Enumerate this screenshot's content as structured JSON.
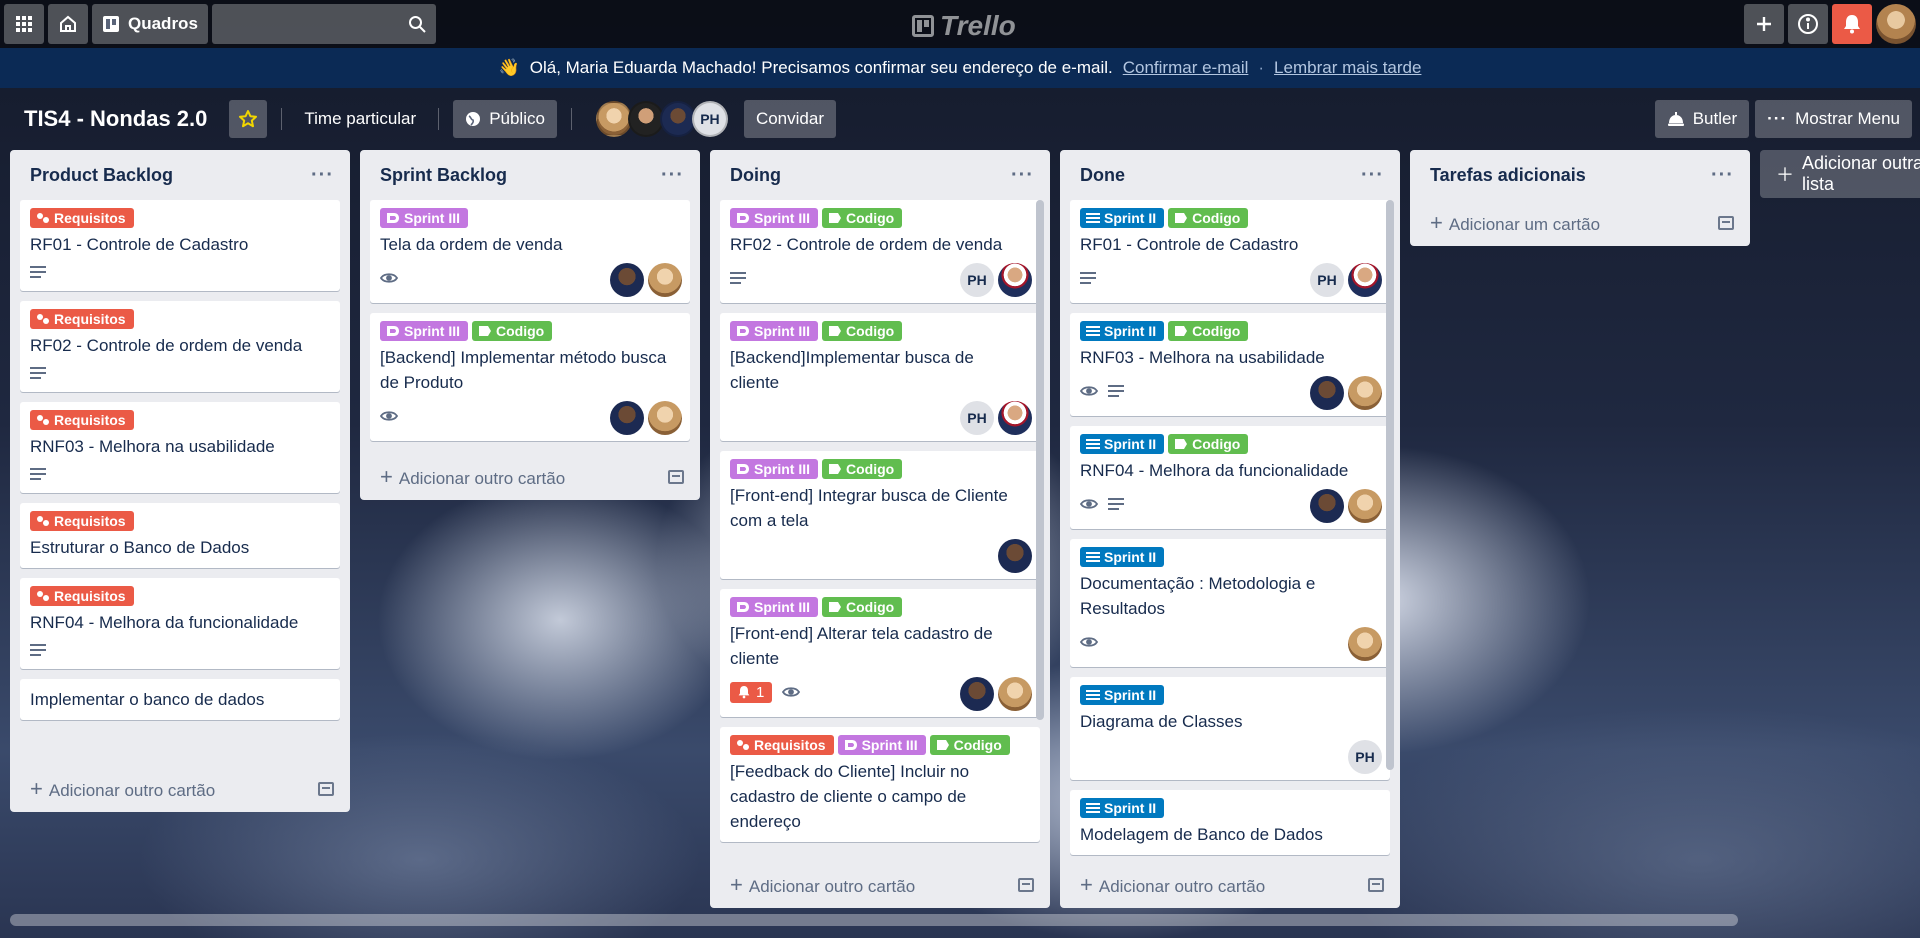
{
  "header": {
    "apps_icon": "grid-icon",
    "home_icon": "home-icon",
    "boards_label": "Quadros",
    "search_placeholder": "",
    "logo_text": "Trello"
  },
  "banner": {
    "emoji": "👋",
    "message": "Olá, Maria Eduarda Machado! Precisamos confirmar seu endereço de e-mail.",
    "confirm_link": "Confirmar e-mail",
    "separator": "·",
    "later_link": "Lembrar mais tarde"
  },
  "board": {
    "title": "TIS4 - Nondas 2.0",
    "team_label": "Time particular",
    "visibility_label": "Público",
    "invite_label": "Convidar",
    "member_initials": "PH",
    "butler_label": "Butler",
    "menu_label": "Mostrar Menu"
  },
  "lists": [
    {
      "title": "Product Backlog",
      "add_label": "Adicionar outro cartão",
      "cards": [
        {
          "labels": [
            {
              "text": "Requisitos",
              "kind": "req"
            }
          ],
          "title": "RF01 - Controle de Cadastro",
          "desc": true
        },
        {
          "labels": [
            {
              "text": "Requisitos",
              "kind": "req"
            }
          ],
          "title": "RF02 - Controle de ordem de venda",
          "desc": true
        },
        {
          "labels": [
            {
              "text": "Requisitos",
              "kind": "req"
            }
          ],
          "title": "RNF03 - Melhora na usabilidade",
          "desc": true
        },
        {
          "labels": [
            {
              "text": "Requisitos",
              "kind": "req"
            }
          ],
          "title": "Estruturar o Banco de Dados"
        },
        {
          "labels": [
            {
              "text": "Requisitos",
              "kind": "req"
            }
          ],
          "title": "RNF04 - Melhora da funcionalidade",
          "desc": true
        },
        {
          "labels": [],
          "title": "Implementar o banco de dados"
        }
      ]
    },
    {
      "title": "Sprint Backlog",
      "add_label": "Adicionar outro cartão",
      "cards": [
        {
          "labels": [
            {
              "text": "Sprint III",
              "kind": "s3"
            }
          ],
          "title": "Tela da ordem de venda",
          "watch": true,
          "members": [
            "d",
            "f"
          ]
        },
        {
          "labels": [
            {
              "text": "Sprint III",
              "kind": "s3"
            },
            {
              "text": "Codigo",
              "kind": "cod"
            }
          ],
          "title": "[Backend] Implementar método busca de Produto",
          "watch": true,
          "members": [
            "d",
            "f"
          ]
        }
      ]
    },
    {
      "title": "Doing",
      "add_label": "Adicionar outro cartão",
      "cards": [
        {
          "labels": [
            {
              "text": "Sprint III",
              "kind": "s3"
            },
            {
              "text": "Codigo",
              "kind": "cod"
            }
          ],
          "title": "RF02 - Controle de ordem de venda",
          "desc": true,
          "members": [
            "ph",
            "s"
          ]
        },
        {
          "labels": [
            {
              "text": "Sprint III",
              "kind": "s3"
            },
            {
              "text": "Codigo",
              "kind": "cod"
            }
          ],
          "title": "[Backend]Implementar busca de cliente",
          "members": [
            "ph",
            "s"
          ]
        },
        {
          "labels": [
            {
              "text": "Sprint III",
              "kind": "s3"
            },
            {
              "text": "Codigo",
              "kind": "cod"
            }
          ],
          "title": "[Front-end] Integrar busca de Cliente com a tela",
          "members": [
            "d"
          ]
        },
        {
          "labels": [
            {
              "text": "Sprint III",
              "kind": "s3"
            },
            {
              "text": "Codigo",
              "kind": "cod"
            }
          ],
          "title": "[Front-end] Alterar tela cadastro de cliente",
          "bell": "1",
          "watch": true,
          "members": [
            "d",
            "f"
          ]
        },
        {
          "labels": [
            {
              "text": "Requisitos",
              "kind": "req"
            },
            {
              "text": "Sprint III",
              "kind": "s3"
            },
            {
              "text": "Codigo",
              "kind": "cod"
            }
          ],
          "title": "[Feedback do Cliente] Incluir no cadastro de cliente o campo de endereço"
        }
      ]
    },
    {
      "title": "Done",
      "add_label": "Adicionar outro cartão",
      "cards": [
        {
          "labels": [
            {
              "text": "Sprint II",
              "kind": "s2"
            },
            {
              "text": "Codigo",
              "kind": "cod"
            }
          ],
          "title": "RF01 - Controle de Cadastro",
          "desc": true,
          "members": [
            "ph",
            "s"
          ]
        },
        {
          "labels": [
            {
              "text": "Sprint II",
              "kind": "s2"
            },
            {
              "text": "Codigo",
              "kind": "cod"
            }
          ],
          "title": "RNF03 - Melhora na usabilidade",
          "watch": true,
          "desc": true,
          "members": [
            "d",
            "f"
          ]
        },
        {
          "labels": [
            {
              "text": "Sprint II",
              "kind": "s2"
            },
            {
              "text": "Codigo",
              "kind": "cod"
            }
          ],
          "title": "RNF04 - Melhora da funcionalidade",
          "watch": true,
          "desc": true,
          "members": [
            "d",
            "f"
          ]
        },
        {
          "labels": [
            {
              "text": "Sprint II",
              "kind": "s2"
            }
          ],
          "title": "Documentação : Metodologia e Resultados",
          "watch": true,
          "members": [
            "f"
          ]
        },
        {
          "labels": [
            {
              "text": "Sprint II",
              "kind": "s2"
            }
          ],
          "title": "Diagrama de Classes",
          "members": [
            "ph"
          ]
        },
        {
          "labels": [
            {
              "text": "Sprint II",
              "kind": "s2"
            }
          ],
          "title": "Modelagem de Banco de Dados"
        }
      ]
    },
    {
      "title": "Tarefas adicionais",
      "add_label": "Adicionar um cartão",
      "cards": []
    }
  ],
  "add_list_label": "Adicionar outra lista",
  "colors": {
    "req": "#eb5a46",
    "sprint3": "#c377e0",
    "sprint2": "#0079bf",
    "codigo": "#61bd4f"
  }
}
